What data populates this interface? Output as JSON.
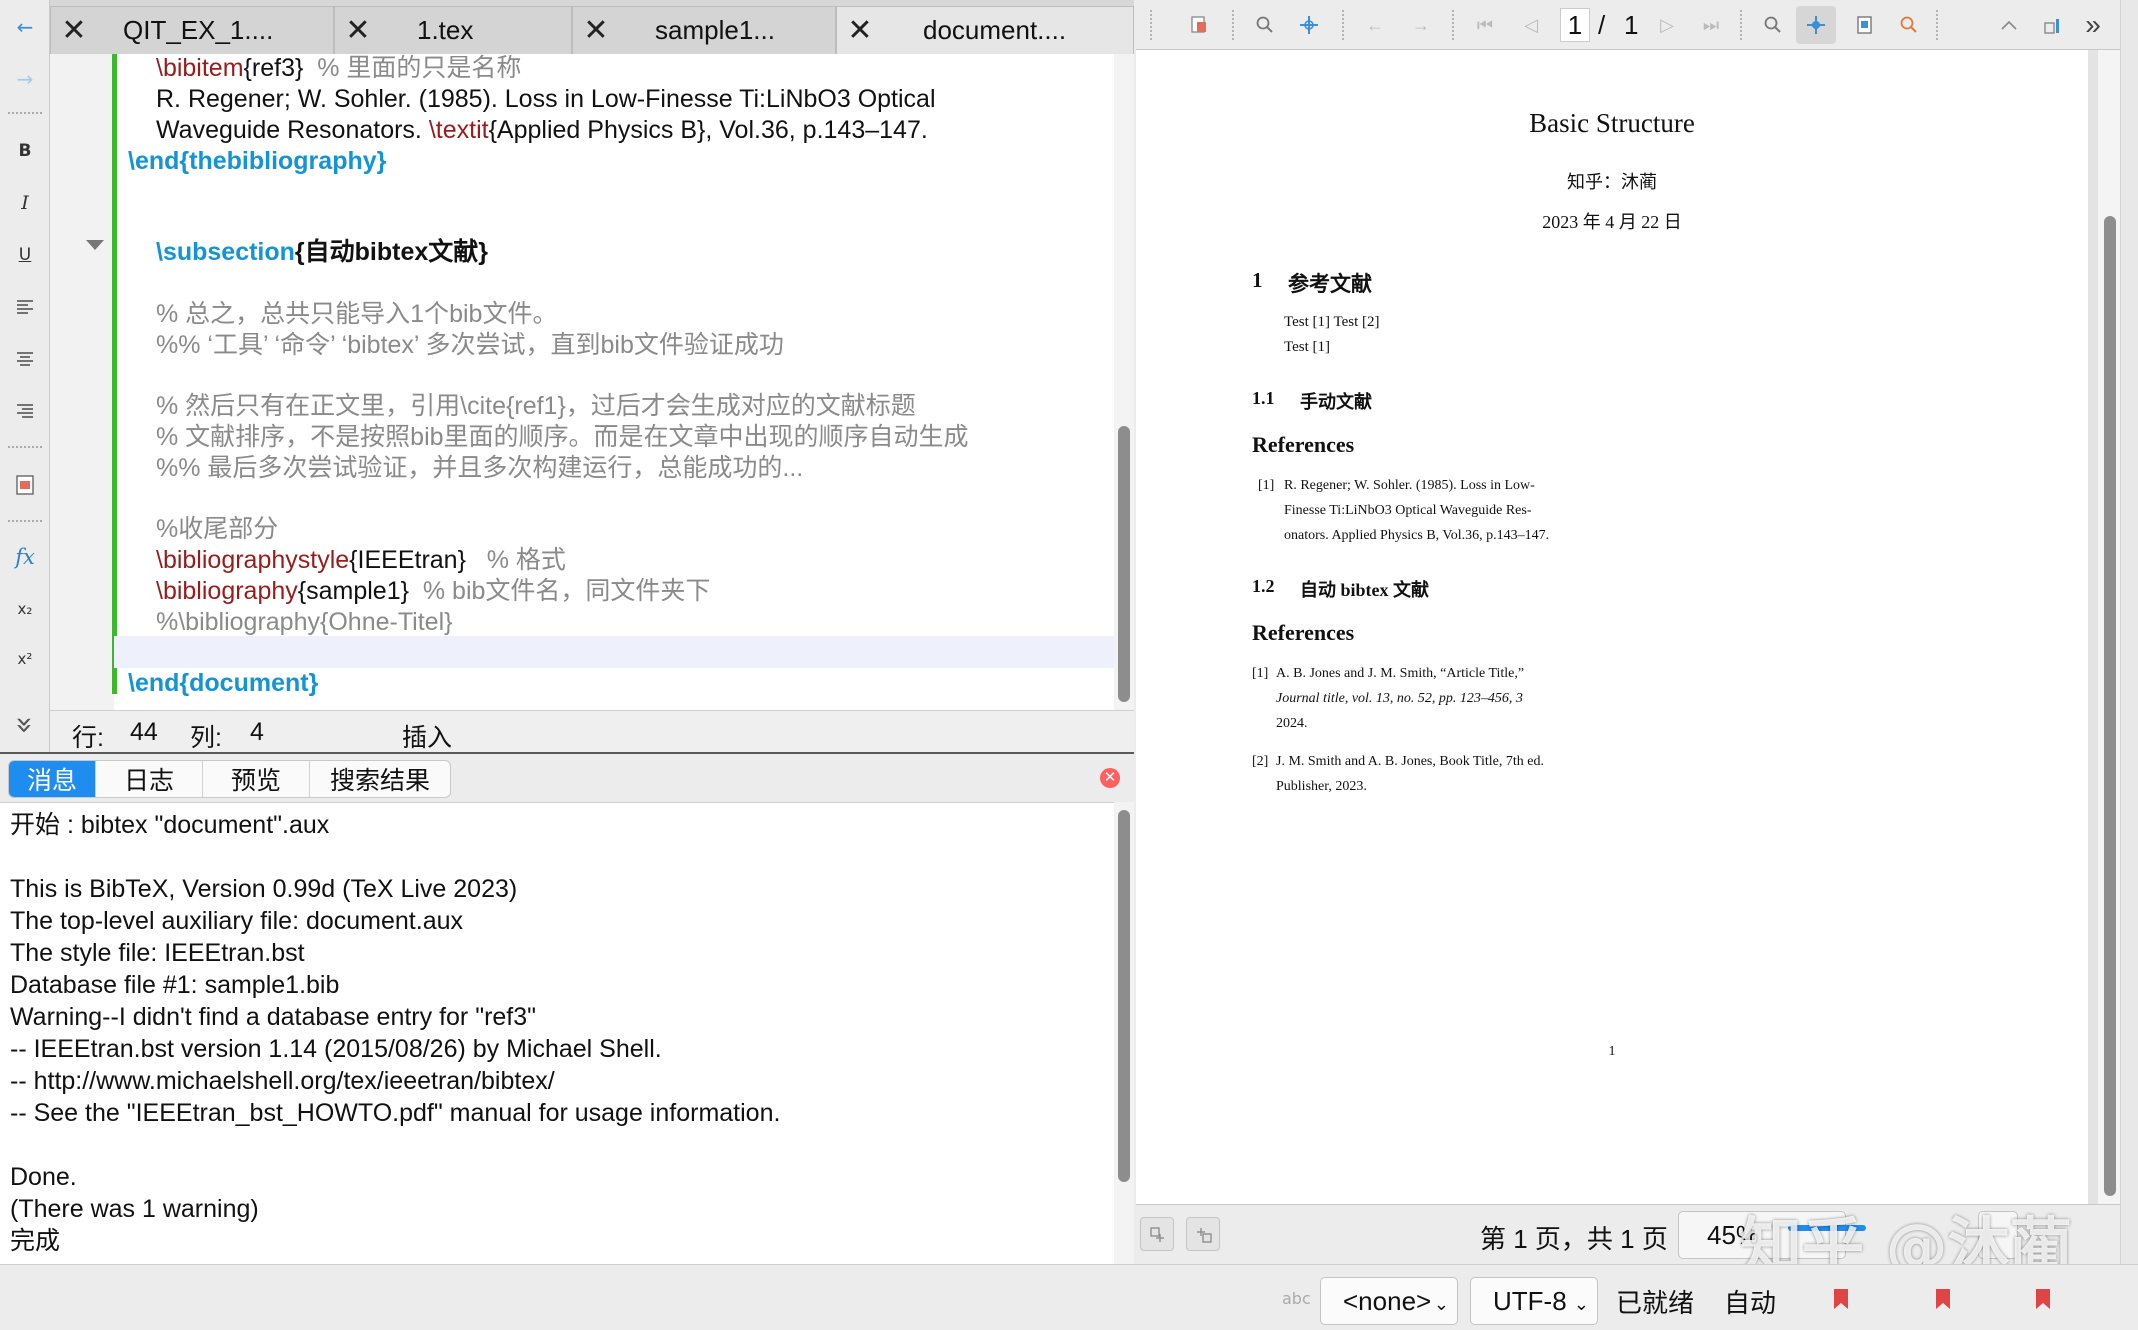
{
  "tabs": [
    {
      "label": "QIT_EX_1....",
      "close": "✕"
    },
    {
      "label": "1.tex",
      "close": "✕"
    },
    {
      "label": "sample1...",
      "close": "✕"
    },
    {
      "label": "document....",
      "close": "✕"
    }
  ],
  "left_toolbar": {
    "back": "←",
    "forward": "→",
    "bold": "B",
    "italic": "I",
    "underline": "U",
    "fx": "fx",
    "subscript": "x₂",
    "superscript": "x²",
    "more": "»"
  },
  "editor": {
    "lines": [
      {
        "cmd": "\\bibitem",
        "arg": "{ref3}",
        "comment": "  % 里面的只是名称"
      },
      {
        "text": "R. Regener; W. Sohler. (1985). Loss in Low-Finesse Ti:LiNbO3 Optical"
      },
      {
        "pre": "Waveguide Resonators. ",
        "cmd": "\\textit",
        "arg": "{Applied Physics B}",
        "post": ", Vol.36, p.143–147."
      },
      {
        "cmd": "\\end",
        "arg": "{thebibliography}"
      },
      {
        "cmd": "\\subsection",
        "arg": "{自动bibtex文献}"
      },
      {
        "comment": "% 总之，总共只能导入1个bib文件。"
      },
      {
        "comment": "%% ‘工具’ ‘命令’ ‘bibtex’ 多次尝试，直到bib文件验证成功"
      },
      {
        "comment": "% 然后只有在正文里，引用\\cite{ref1}，过后才会生成对应的文献标题"
      },
      {
        "comment": "% 文献排序，不是按照bib里面的顺序。而是在文章中出现的顺序自动生成"
      },
      {
        "comment": "%% 最后多次尝试验证，并且多次构建运行，总能成功的..."
      },
      {
        "comment": "%收尾部分"
      },
      {
        "cmd": "\\bibliographystyle",
        "arg": "{IEEEtran}",
        "comment": "   % 格式"
      },
      {
        "cmd": "\\bibliography",
        "arg": "{sample1}",
        "comment": "  % bib文件名，同文件夹下"
      },
      {
        "comment": "%\\bibliography{Ohne-Titel}"
      },
      {
        "cmd": "\\end",
        "arg": "{document}"
      }
    ],
    "status": {
      "row_label": "行:",
      "row": "44",
      "col_label": "列:",
      "col": "4",
      "mode": "插入"
    }
  },
  "messages": {
    "tabs": [
      "消息",
      "日志",
      "预览",
      "搜索结果"
    ],
    "lines": [
      "开始 : bibtex \"document\".aux",
      "",
      "This is BibTeX, Version 0.99d (TeX Live 2023)",
      "The top-level auxiliary file: document.aux",
      "The style file: IEEEtran.bst",
      "Database file #1: sample1.bib",
      "Warning--I didn't find a database entry for \"ref3\"",
      "-- IEEEtran.bst version 1.14 (2015/08/26) by Michael Shell.",
      "-- http://www.michaelshell.org/tex/ieeetran/bibtex/",
      "-- See the \"IEEEtran_bst_HOWTO.pdf\" manual for usage information.",
      "",
      "Done.",
      "(There was 1 warning)",
      "完成"
    ]
  },
  "preview_toolbar": {
    "page_current": "1",
    "page_sep": "/",
    "page_total": "1"
  },
  "pdf": {
    "title": "Basic Structure",
    "author": "知乎：沐蔺",
    "date": "2023 年 4 月 22 日",
    "sec1_num": "1",
    "sec1_title": "参考文献",
    "test_line1": "Test [1] Test [2]",
    "test_line2": "Test [1]",
    "sub11_num": "1.1",
    "sub11_title": "手动文献",
    "refs_heading1": "References",
    "ref_manual_num": "[1]",
    "ref_manual_lines": [
      "R. Regener; W. Sohler. (1985). Loss in Low-",
      "Finesse  Ti:LiNbO3  Optical  Waveguide  Res-",
      "onators. Applied Physics B, Vol.36, p.143–147."
    ],
    "sub12_num": "1.2",
    "sub12_title": "自动 bibtex 文献",
    "refs_heading2": "References",
    "ref_auto1_num": "[1]",
    "ref_auto1_lines": [
      "A. B. Jones and J. M. Smith, “Article Title,”",
      "Journal  title,  vol.  13,  no.  52,  pp.  123–456,  3",
      "2024."
    ],
    "ref_auto2_num": "[2]",
    "ref_auto2_line1": "J. M. Smith and A. B. Jones, Book Title, 7th ed.",
    "ref_auto2_line2": "Publisher, 2023.",
    "page_number": "1"
  },
  "preview_nav": {
    "page_info": "第 1 页，共 1 页",
    "zoom": "45%"
  },
  "watermark": "知乎 @沐蔺",
  "statusbar": {
    "spell_icon": "abc",
    "language": "<none>",
    "encoding": "UTF-8",
    "ready": "已就绪",
    "auto": "自动"
  },
  "colors": {
    "latex_command": "#9b1b1b",
    "latex_structure": "#1394d6",
    "comment": "#8a8a8a",
    "modified_bar": "#3db82e",
    "active_tab": "#1f8cf0"
  }
}
